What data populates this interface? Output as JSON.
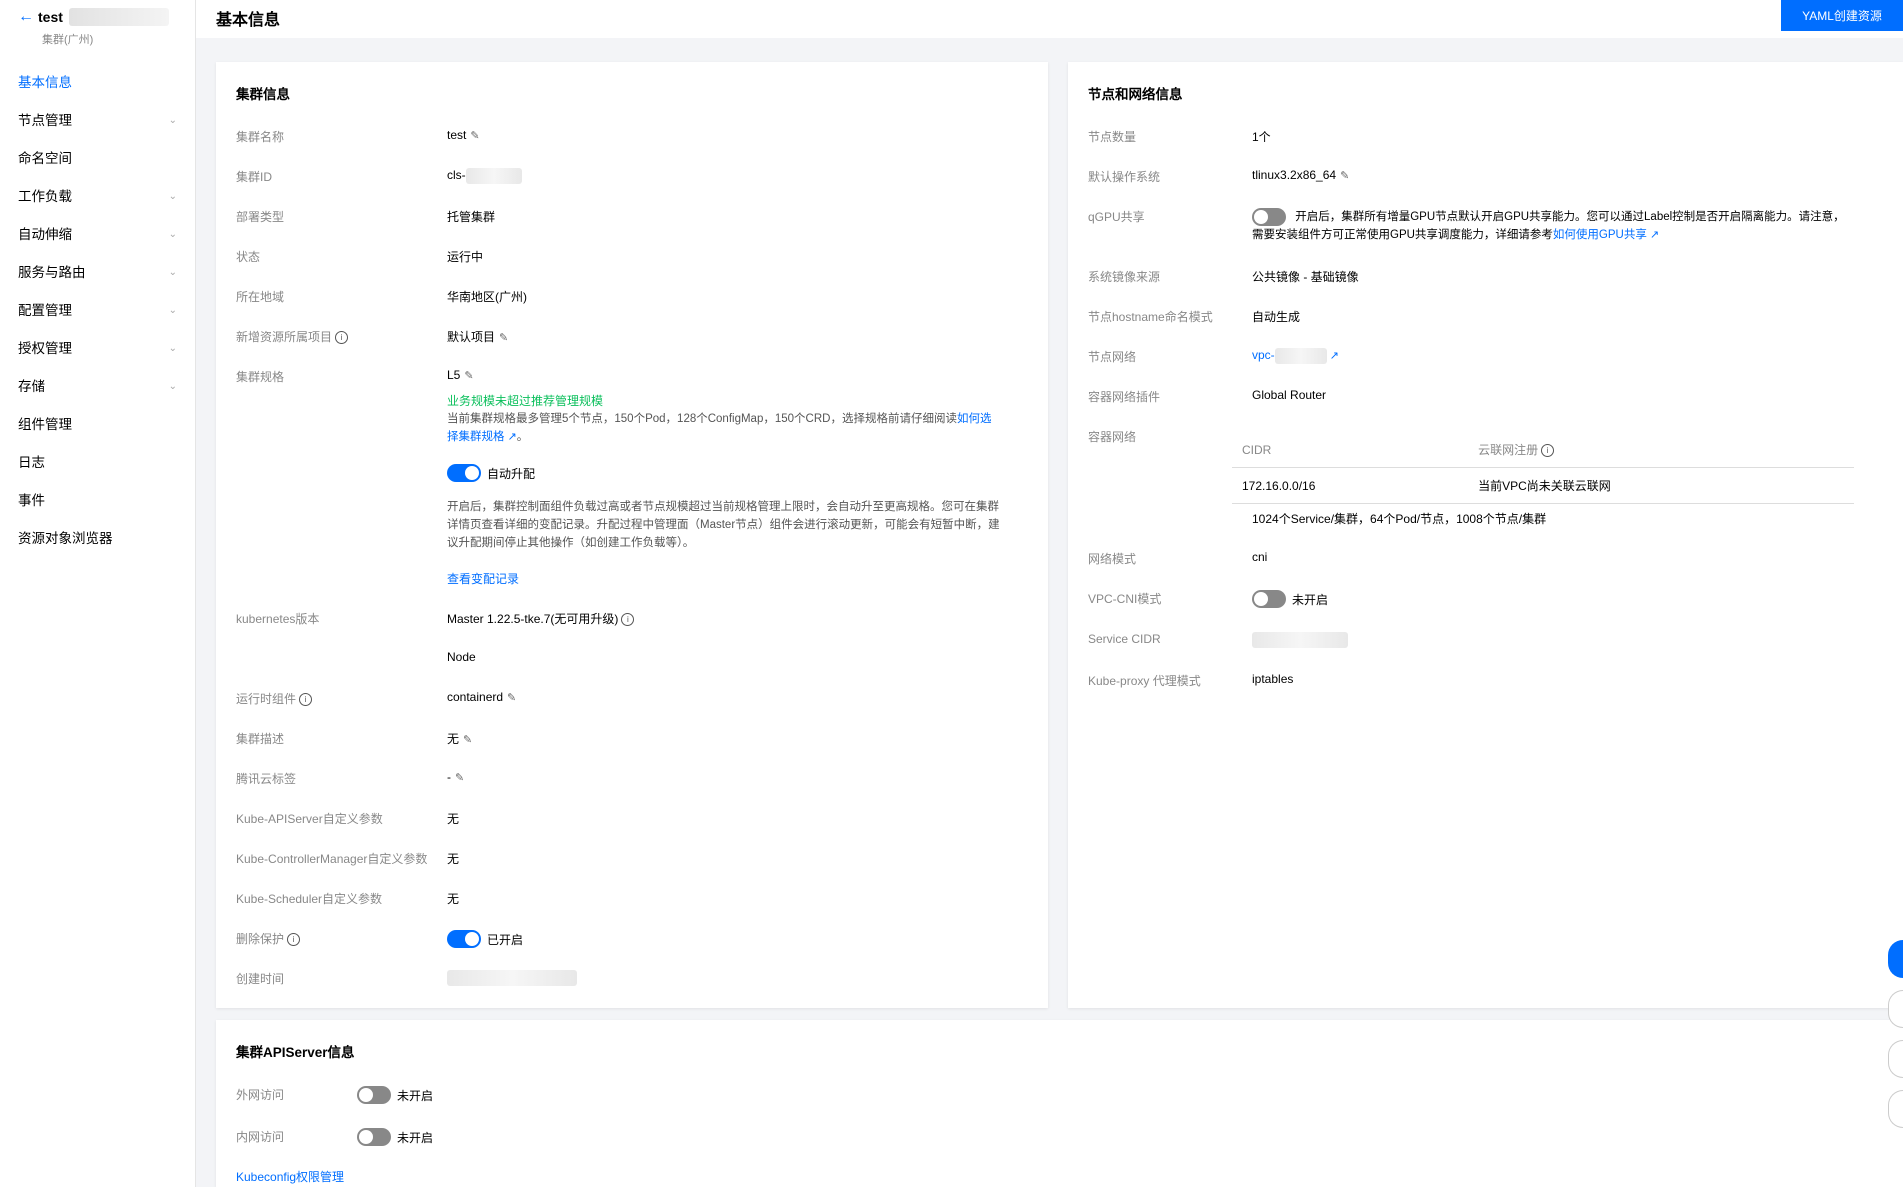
{
  "sidebar": {
    "title": "test",
    "subtitle": "集群(广州)",
    "items": [
      {
        "label": "基本信息",
        "chevron": false
      },
      {
        "label": "节点管理",
        "chevron": true
      },
      {
        "label": "命名空间",
        "chevron": false
      },
      {
        "label": "工作负载",
        "chevron": true
      },
      {
        "label": "自动伸缩",
        "chevron": true
      },
      {
        "label": "服务与路由",
        "chevron": true
      },
      {
        "label": "配置管理",
        "chevron": true
      },
      {
        "label": "授权管理",
        "chevron": true
      },
      {
        "label": "存储",
        "chevron": true
      },
      {
        "label": "组件管理",
        "chevron": false
      },
      {
        "label": "日志",
        "chevron": false
      },
      {
        "label": "事件",
        "chevron": false
      },
      {
        "label": "资源对象浏览器",
        "chevron": false
      }
    ]
  },
  "header": {
    "title": "基本信息",
    "yaml_button": "YAML创建资源"
  },
  "cluster_info": {
    "title": "集群信息",
    "name_label": "集群名称",
    "name_value": "test",
    "id_label": "集群ID",
    "id_value": "cls-",
    "deploy_label": "部署类型",
    "deploy_value": "托管集群",
    "status_label": "状态",
    "status_value": "运行中",
    "region_label": "所在地域",
    "region_value": "华南地区(广州)",
    "project_label": "新增资源所属项目",
    "project_value": "默认项目",
    "spec_label": "集群规格",
    "spec_value": "L5",
    "spec_hint": "业务规模未超过推荐管理规模",
    "spec_desc": "当前集群规格最多管理5个节点，150个Pod，128个ConfigMap，150个CRD，选择规格前请仔细阅读",
    "spec_link": "如何选择集群规格",
    "spec_desc_end": "。",
    "auto_upgrade_label": "自动升配",
    "auto_upgrade_desc": "开启后，集群控制面组件负载过高或者节点规模超过当前规格管理上限时，会自动升至更高规格。您可在集群详情页查看详细的变配记录。升配过程中管理面（Master节点）组件会进行滚动更新，可能会有短暂中断，建议升配期间停止其他操作（如创建工作负载等）。",
    "change_record_link": "查看变配记录",
    "k8s_label": "kubernetes版本",
    "k8s_master": "Master 1.22.5-tke.7(无可用升级)",
    "k8s_node": "Node",
    "runtime_label": "运行时组件",
    "runtime_value": "containerd",
    "desc_label": "集群描述",
    "desc_value": "无",
    "tag_label": "腾讯云标签",
    "tag_value": "-",
    "apiserver_param_label": "Kube-APIServer自定义参数",
    "apiserver_param_value": "无",
    "cm_param_label": "Kube-ControllerManager自定义参数",
    "cm_param_value": "无",
    "sched_param_label": "Kube-Scheduler自定义参数",
    "sched_param_value": "无",
    "delete_protect_label": "删除保护",
    "delete_protect_value": "已开启",
    "created_label": "创建时间"
  },
  "node_network": {
    "title": "节点和网络信息",
    "node_count_label": "节点数量",
    "node_count_value": "1个",
    "os_label": "默认操作系统",
    "os_value": "tlinux3.2x86_64",
    "qgpu_label": "qGPU共享",
    "qgpu_desc_1": "开启后，集群所有增量GPU节点默认开启GPU共享能力。您可以通过Label控制是否开启隔离能力。请注意，",
    "qgpu_desc_2": "需要安装组件方可正常使用GPU共享调度能力，详细请参考",
    "qgpu_link": "如何使用GPU共享",
    "image_label": "系统镜像来源",
    "image_value": "公共镜像 - 基础镜像",
    "hostname_label": "节点hostname命名模式",
    "hostname_value": "自动生成",
    "node_net_label": "节点网络",
    "node_net_value": "vpc-",
    "cni_plugin_label": "容器网络插件",
    "cni_plugin_value": "Global Router",
    "container_net_label": "容器网络",
    "cidr_header": "CIDR",
    "ccn_header": "云联网注册",
    "cidr_value": "172.16.0.0/16",
    "ccn_value": "当前VPC尚未关联云联网",
    "capacity": "1024个Service/集群，64个Pod/节点，1008个节点/集群",
    "net_mode_label": "网络模式",
    "net_mode_value": "cni",
    "vpc_cni_label": "VPC-CNI模式",
    "vpc_cni_value": "未开启",
    "service_cidr_label": "Service CIDR",
    "kube_proxy_label": "Kube-proxy 代理模式",
    "kube_proxy_value": "iptables"
  },
  "apiserver": {
    "title": "集群APIServer信息",
    "public_label": "外网访问",
    "public_value": "未开启",
    "private_label": "内网访问",
    "private_value": "未开启",
    "kubeconfig_link": "Kubeconfig权限管理"
  },
  "colors": {
    "accent": "#006eff",
    "success": "#0abf5b"
  }
}
